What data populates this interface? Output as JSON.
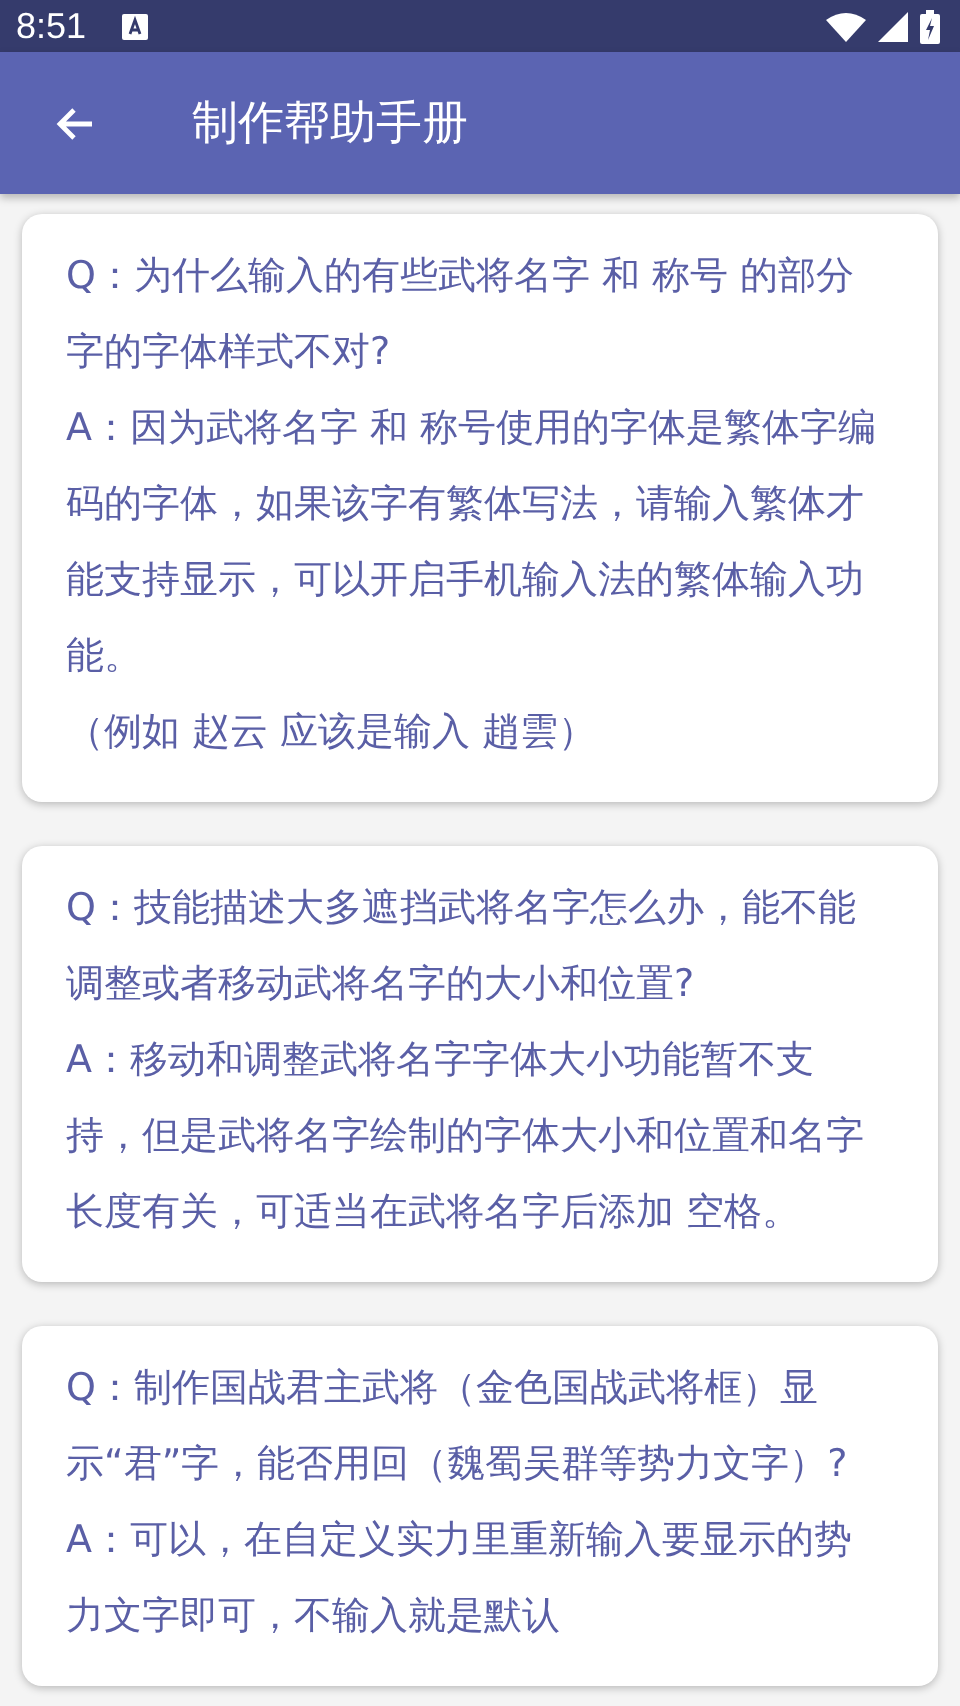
{
  "status_bar": {
    "time": "8:51"
  },
  "toolbar": {
    "title": "制作帮助手册"
  },
  "faq": [
    {
      "question": "Q：为什么输入的有些武将名字 和 称号 的部分字的字体样式不对?",
      "answer": "A：因为武将名字 和 称号使用的字体是繁体字编码的字体，如果该字有繁体写法，请输入繁体才能支持显示，可以开启手机输入法的繁体输入功能。",
      "note": "（例如 赵云 应该是输入 趙雲）"
    },
    {
      "question": "Q：技能描述大多遮挡武将名字怎么办，能不能调整或者移动武将名字的大小和位置?",
      "answer": "A：移动和调整武将名字字体大小功能暂不支持，但是武将名字绘制的字体大小和位置和名字长度有关，可适当在武将名字后添加 空格。"
    },
    {
      "question": "Q：制作国战君主武将（金色国战武将框）显示“君”字，能否用回（魏蜀吴群等势力文字）?",
      "answer": "A：可以，在自定义实力里重新输入要显示的势力文字即可，不输入就是默认"
    }
  ]
}
